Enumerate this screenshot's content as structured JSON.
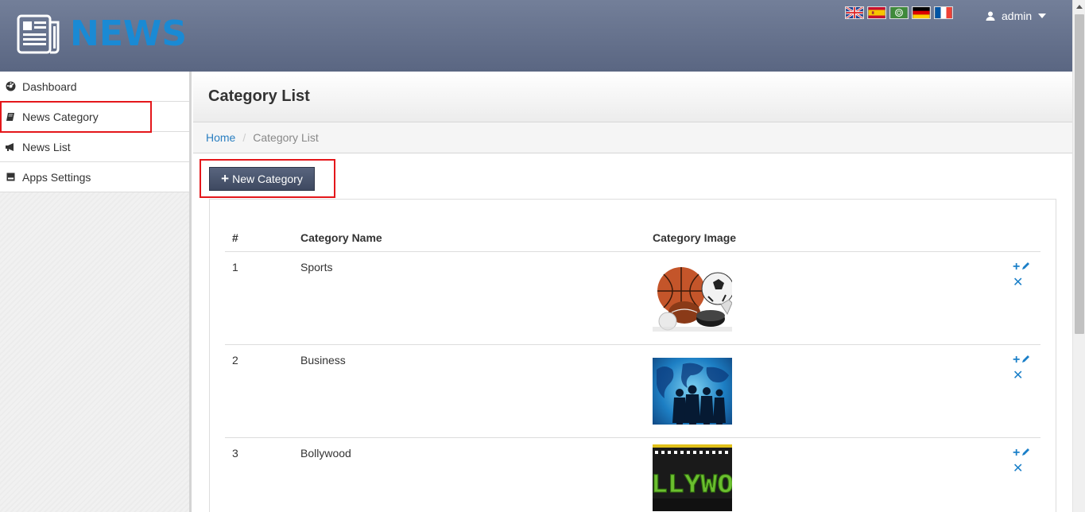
{
  "header": {
    "logo_text": "NEWS",
    "flags": [
      "uk-flag-icon",
      "spain-flag-icon",
      "arabic-flag-icon",
      "germany-flag-icon",
      "france-flag-icon"
    ],
    "user_label": "admin"
  },
  "sidebar": {
    "items": [
      {
        "label": "Dashboard",
        "icon": "dashboard-icon"
      },
      {
        "label": "News Category",
        "icon": "book-icon"
      },
      {
        "label": "News List",
        "icon": "bullhorn-icon"
      },
      {
        "label": "Apps Settings",
        "icon": "hdd-icon"
      }
    ]
  },
  "page": {
    "title": "Category List",
    "breadcrumb": {
      "home": "Home",
      "separator": "/",
      "current": "Category List"
    },
    "new_button": "New Category"
  },
  "table": {
    "columns": [
      "#",
      "Category Name",
      "Category Image"
    ],
    "rows": [
      {
        "num": "1",
        "name": "Sports",
        "image": "sports-balls-image"
      },
      {
        "num": "2",
        "name": "Business",
        "image": "business-world-image"
      },
      {
        "num": "3",
        "name": "Bollywood",
        "image": "bollywood-image",
        "image_text": "LLYWO"
      }
    ]
  },
  "colors": {
    "topbar": "#636f8c",
    "logo": "#1a8ad4",
    "accent_link": "#2a7fc1",
    "highlight_box": "#e4171b",
    "button": "#4b5670"
  }
}
